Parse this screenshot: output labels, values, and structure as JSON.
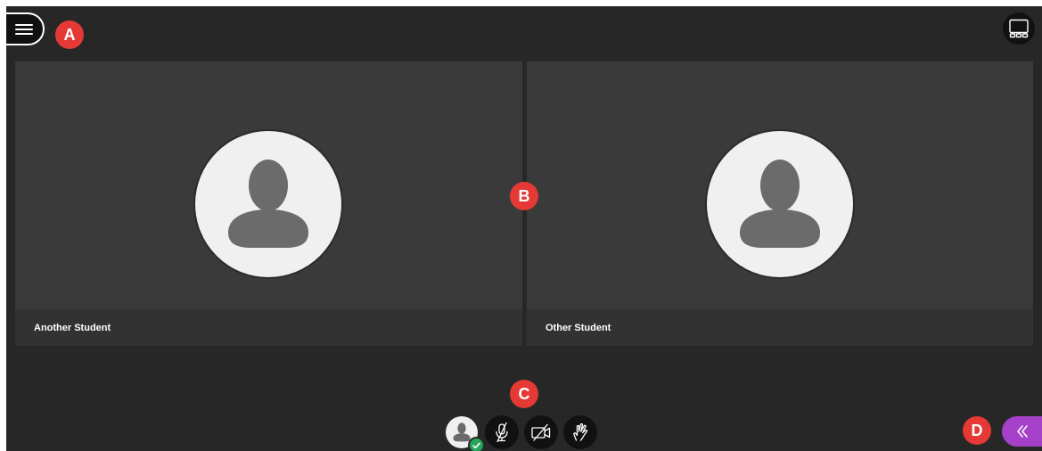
{
  "annotations": {
    "a": "A",
    "b": "B",
    "c": "C",
    "d": "D"
  },
  "header": {
    "menu_icon": "hamburger-menu-icon",
    "layout_icon": "gallery-layout-icon"
  },
  "participants": [
    {
      "name": "Another Student",
      "avatar_icon": "person-silhouette-icon"
    },
    {
      "name": "Other Student",
      "avatar_icon": "person-silhouette-icon"
    }
  ],
  "controls": {
    "profile_icon": "person-silhouette-icon",
    "status_icon": "checkmark-icon",
    "microphone_icon": "microphone-off-icon",
    "camera_icon": "camera-off-icon",
    "hand_icon": "raise-hand-icon",
    "panel_icon": "double-chevron-left-icon"
  },
  "colors": {
    "stage_background": "#272727",
    "tile_background": "#3a3a3a",
    "annotation_red": "#e53935",
    "status_green": "#26a65b",
    "panel_purple": "#a441c8"
  }
}
